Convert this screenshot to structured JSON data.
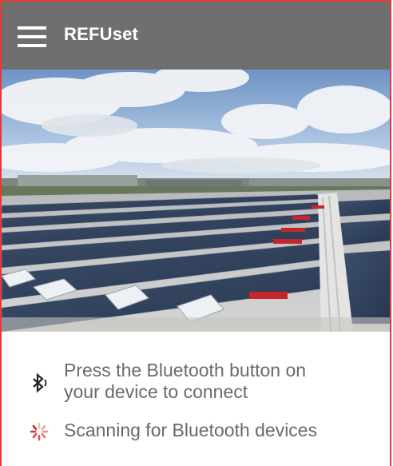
{
  "app": {
    "title": "REFUset"
  },
  "hero": {
    "description_icon": "solar-roof-photo"
  },
  "status": {
    "bluetooth_instruction_line1": "Press the Bluetooth button on",
    "bluetooth_instruction_line2": "your device to connect",
    "scanning_text": "Scanning for Bluetooth devices",
    "bluetooth_icon": "bluetooth-icon",
    "spinner_icon": "spinner-icon"
  },
  "colors": {
    "appbar": "#6f6f6f",
    "accent": "#e53935",
    "text": "#6a6a6a"
  }
}
